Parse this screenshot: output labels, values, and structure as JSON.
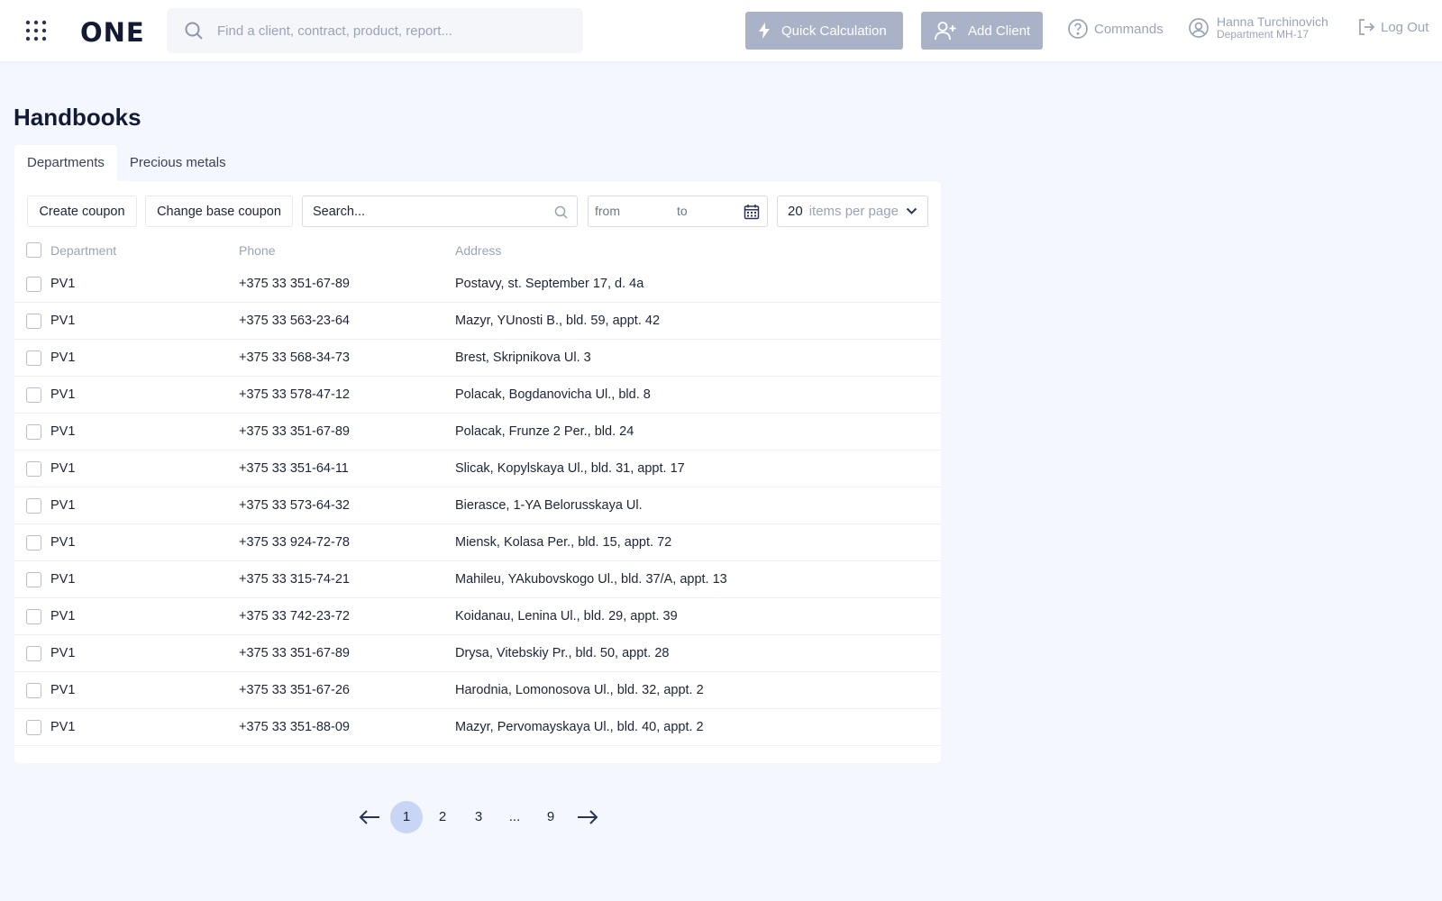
{
  "header": {
    "logo": "ONE",
    "search_placeholder": "Find a client, contract, product, report...",
    "quick_calc_label": "Quick Calculation",
    "add_client_label": "Add Client",
    "commands_label": "Commands",
    "user_name": "Hanna Turchinovich",
    "user_department": "Department MH-17",
    "logout_label": "Log Out"
  },
  "page": {
    "title": "Handbooks"
  },
  "tabs": [
    {
      "label": "Departments",
      "active": true
    },
    {
      "label": "Precious metals",
      "active": false
    }
  ],
  "toolbar": {
    "create_coupon": "Create coupon",
    "change_base_coupon": "Change base coupon",
    "search_placeholder": "Search...",
    "date_from_placeholder": "from",
    "date_to_placeholder": "to",
    "per_page_value": "20",
    "per_page_label": "items per page"
  },
  "table": {
    "columns": {
      "department": "Department",
      "phone": "Phone",
      "address": "Address"
    },
    "rows": [
      {
        "department": "PV1",
        "phone": "+375 33 351-67-89",
        "address": "Postavy, st. September 17, d. 4a"
      },
      {
        "department": "PV1",
        "phone": "+375 33 563-23-64",
        "address": "Mazyr, YUnosti B., bld. 59, appt. 42"
      },
      {
        "department": "PV1",
        "phone": "+375 33 568-34-73",
        "address": "Brest, Skripnikova Ul. 3"
      },
      {
        "department": "PV1",
        "phone": "+375 33 578-47-12",
        "address": "Polacak, Bogdanovicha Ul., bld. 8"
      },
      {
        "department": "PV1",
        "phone": "+375 33 351-67-89",
        "address": "Polacak, Frunze 2 Per., bld. 24"
      },
      {
        "department": "PV1",
        "phone": "+375 33 351-64-11",
        "address": "Slicak, Kopylskaya Ul., bld. 31, appt. 17"
      },
      {
        "department": "PV1",
        "phone": "+375 33 573-64-32",
        "address": "Bierasce, 1-YA Belorusskaya Ul."
      },
      {
        "department": "PV1",
        "phone": "+375 33 924-72-78",
        "address": "Miensk, Kolasa Per., bld. 15, appt. 72"
      },
      {
        "department": "PV1",
        "phone": "+375 33 315-74-21",
        "address": "Mahileu, YAkubovskogo Ul., bld. 37/A, appt. 13"
      },
      {
        "department": "PV1",
        "phone": "+375 33 742-23-72",
        "address": "Koidanau, Lenina Ul., bld. 29, appt. 39"
      },
      {
        "department": "PV1",
        "phone": "+375 33 351-67-89",
        "address": "Drysa, Vitebskiy Pr., bld. 50, appt. 28"
      },
      {
        "department": "PV1",
        "phone": "+375 33 351-67-26",
        "address": "Harodnia, Lomonosova Ul., bld. 32, appt. 2"
      },
      {
        "department": "PV1",
        "phone": "+375 33 351-88-09",
        "address": "Mazyr, Pervomayskaya Ul., bld. 40, appt. 2"
      }
    ]
  },
  "pagination": {
    "pages": [
      "1",
      "2",
      "3",
      "...",
      "9"
    ],
    "current": "1"
  },
  "icons": {
    "apps": "grid-icon",
    "search": "search-icon",
    "quick": "lightning-icon",
    "add_client": "user-plus-icon",
    "commands": "help-circle-icon",
    "user": "user-circle-icon",
    "logout": "logout-icon",
    "calendar": "calendar-icon",
    "per_page": "chevron-down-icon",
    "prev": "arrow-left-icon",
    "next": "arrow-right-icon"
  },
  "colors": {
    "background": "#f4f7fd",
    "accent_button": "#aab2c7",
    "active_page": "#c9d5f5",
    "text": "#1c2438",
    "muted": "#9aa3b6"
  }
}
